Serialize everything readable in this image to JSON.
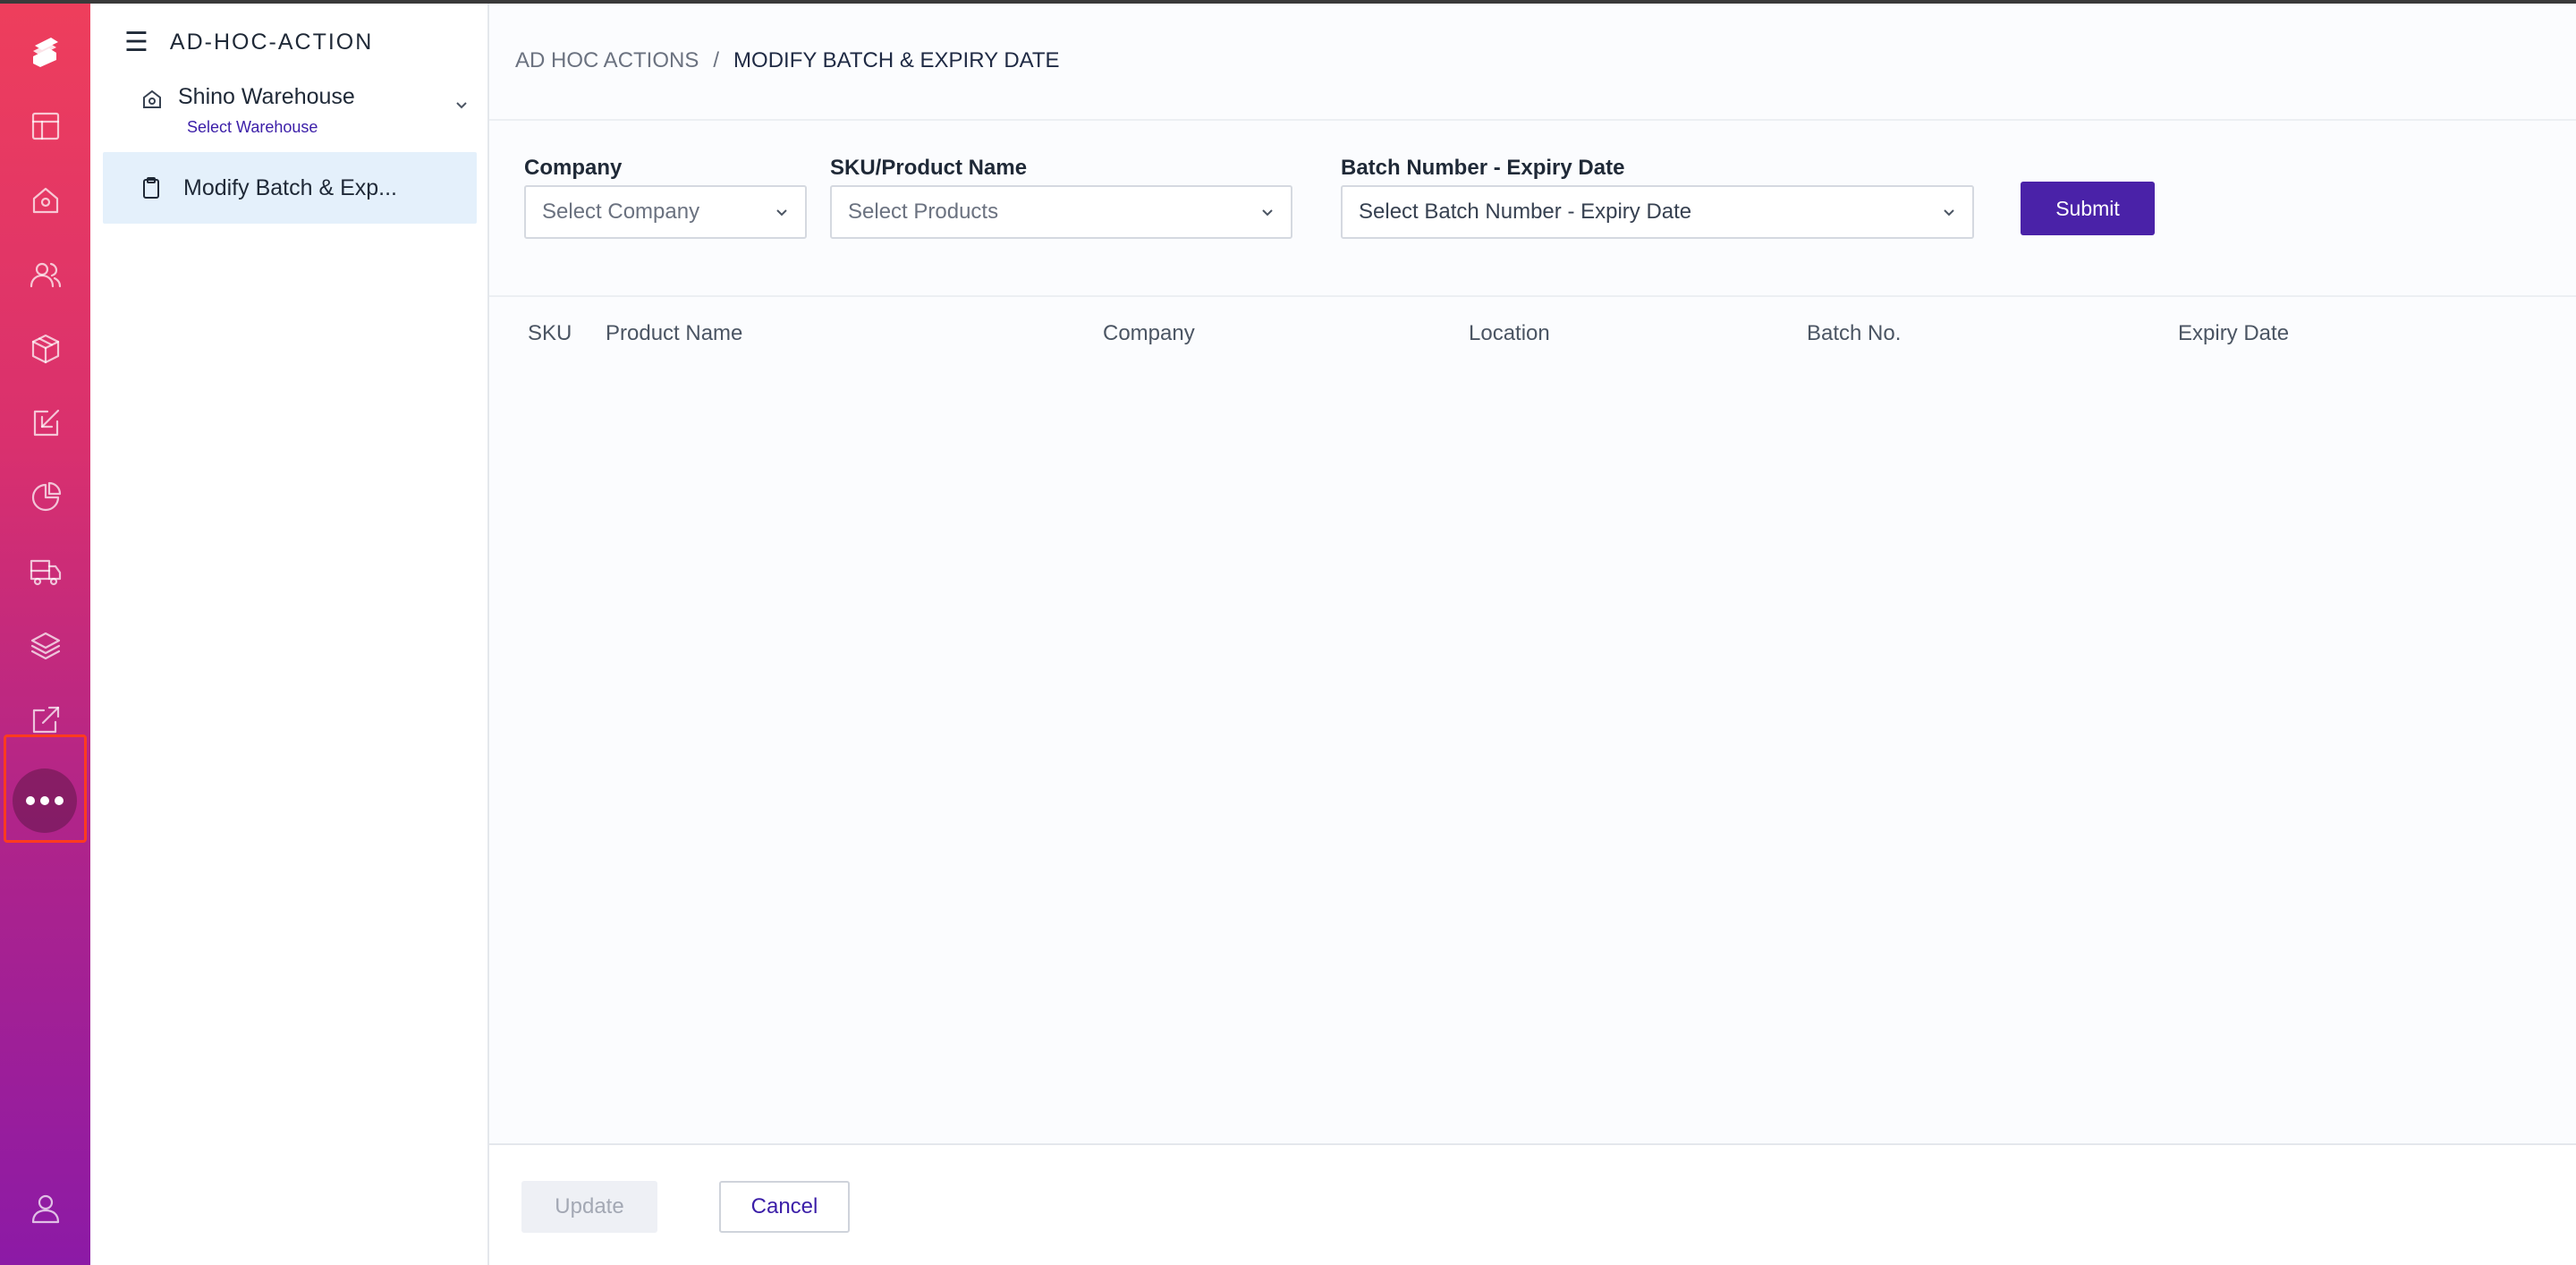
{
  "sidebar": {
    "title": "AD-HOC-ACTION",
    "warehouse": {
      "name": "Shino Warehouse",
      "sub_label": "Select Warehouse"
    },
    "items": [
      {
        "label": "Modify Batch & Exp..."
      }
    ]
  },
  "rail": {
    "icons": [
      "logo-icon",
      "layout-icon",
      "home-icon",
      "users-icon",
      "box-icon",
      "inbound-icon",
      "pie-chart-icon",
      "truck-icon",
      "layers-icon",
      "external-link-icon",
      "more-icon",
      "user-icon"
    ]
  },
  "breadcrumb": {
    "parent": "AD HOC ACTIONS",
    "separator": "/",
    "current": "MODIFY BATCH & EXPIRY DATE"
  },
  "filters": {
    "company": {
      "label": "Company",
      "placeholder": "Select Company"
    },
    "product": {
      "label": "SKU/Product Name",
      "placeholder": "Select Products"
    },
    "batch": {
      "label": "Batch Number - Expiry Date",
      "placeholder": "Select Batch Number - Expiry Date"
    },
    "submit_label": "Submit"
  },
  "table": {
    "columns": [
      "SKU",
      "Product Name",
      "Company",
      "Location",
      "Batch No.",
      "Expiry Date"
    ],
    "rows": []
  },
  "footer": {
    "update_label": "Update",
    "cancel_label": "Cancel"
  },
  "colors": {
    "accent": "#4a22a8",
    "rail_top": "#ee3e5c",
    "rail_bottom": "#8c1aa6",
    "highlight": "#ff3b1f"
  }
}
